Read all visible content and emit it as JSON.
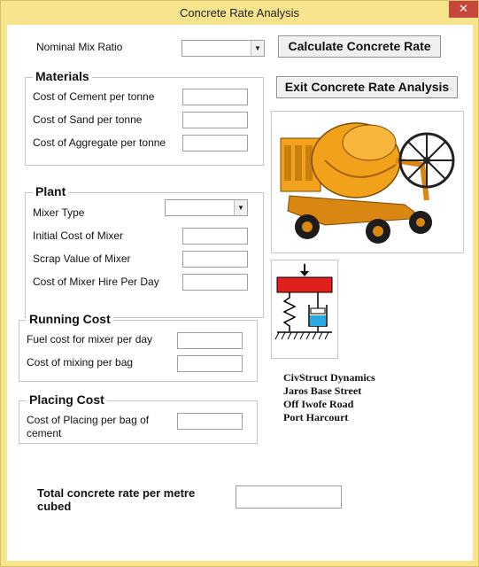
{
  "window": {
    "title": "Concrete Rate Analysis",
    "close_glyph": "✕"
  },
  "mix": {
    "label": "Nominal Mix Ratio",
    "value": ""
  },
  "buttons": {
    "calculate": "Calculate Concrete Rate",
    "exit": "Exit Concrete Rate Analysis"
  },
  "materials": {
    "title": "Materials",
    "cement_label": "Cost of Cement per tonne",
    "sand_label": "Cost of Sand per tonne",
    "aggregate_label": "Cost of Aggregate per tonne"
  },
  "plant": {
    "title": "Plant",
    "mixer_type_label": "Mixer Type",
    "initial_cost_label": "Initial Cost of Mixer",
    "scrap_value_label": "Scrap Value of Mixer",
    "hire_label": "Cost of Mixer Hire Per Day"
  },
  "running": {
    "title": "Running Cost",
    "fuel_label": "Fuel cost for mixer per day",
    "mixing_label": "Cost of mixing per bag"
  },
  "placing": {
    "title": "Placing Cost",
    "placing_label_1": "Cost of Placing per bag of",
    "placing_label_2": "cement"
  },
  "total": {
    "label_1": "Total concrete rate per metre",
    "label_2": "cubed"
  },
  "company": {
    "line1": "CivStruct Dynamics",
    "line2": "Jaros Base Street",
    "line3": "Off Iwofe Road",
    "line4": "Port Harcourt"
  },
  "icons": {
    "dropdown": "chevron-down-icon",
    "mixer_image": "concrete-mixer-icon",
    "logo": "spring-damper-logo-icon"
  },
  "colors": {
    "window_frame": "#f9e48e",
    "close_button": "#c8473d",
    "logo_red": "#e0201a",
    "logo_blue": "#2aa8df",
    "mixer_orange": "#f2a21a"
  }
}
